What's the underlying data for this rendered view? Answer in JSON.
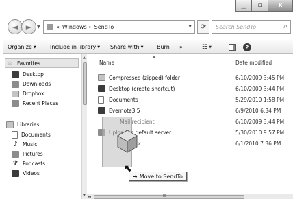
{
  "window": {
    "caption_buttons": [
      "minimize",
      "maximize",
      "close"
    ],
    "close_glyph": "x"
  },
  "address": {
    "overflow": "«",
    "crumbs": [
      "Windows",
      "SendTo"
    ],
    "separator": "▸"
  },
  "search": {
    "placeholder": "Search SendTo"
  },
  "toolbar": {
    "organize": "Organize",
    "include": "Include in library",
    "share": "Share with",
    "burn": "Burn",
    "more": "»"
  },
  "sidebar": {
    "favorites": {
      "label": "Favorites",
      "items": [
        "Desktop",
        "Downloads",
        "Dropbox",
        "Recent Places"
      ]
    },
    "libraries": {
      "label": "Libraries",
      "items": [
        "Documents",
        "Music",
        "Pictures",
        "Podcasts",
        "Videos"
      ]
    }
  },
  "columns": {
    "name": "Name",
    "date": "Date modified"
  },
  "files": [
    {
      "name": "Compressed (zipped) folder",
      "date": "6/10/2009 3:45 PM",
      "icon": "zip-folder-icon"
    },
    {
      "name": "Desktop (create shortcut)",
      "date": "6/10/2009 3:44 PM",
      "icon": "desktop-icon"
    },
    {
      "name": "Documents",
      "date": "5/29/2010 1:58 PM",
      "icon": "documents-icon"
    },
    {
      "name": "Evernote3.5",
      "date": "6/9/2010 6:34 PM",
      "icon": "evernote-icon"
    },
    {
      "name": "",
      "date": "6/10/2009 3:44 PM",
      "icon": "mail-recipient-icon"
    },
    {
      "name": "Upload to default server",
      "date": "5/30/2010 9:57 PM",
      "icon": "upload-icon"
    },
    {
      "name": "",
      "date": "6/1/2010 7:36 PM",
      "icon": "dropbox-icon"
    }
  ],
  "drag": {
    "ghost_lines": [
      "Mail recipient",
      "Fax"
    ],
    "tooltip": "Move to SendTo",
    "tooltip_arrow": "➜"
  },
  "hscroll_label": "III"
}
